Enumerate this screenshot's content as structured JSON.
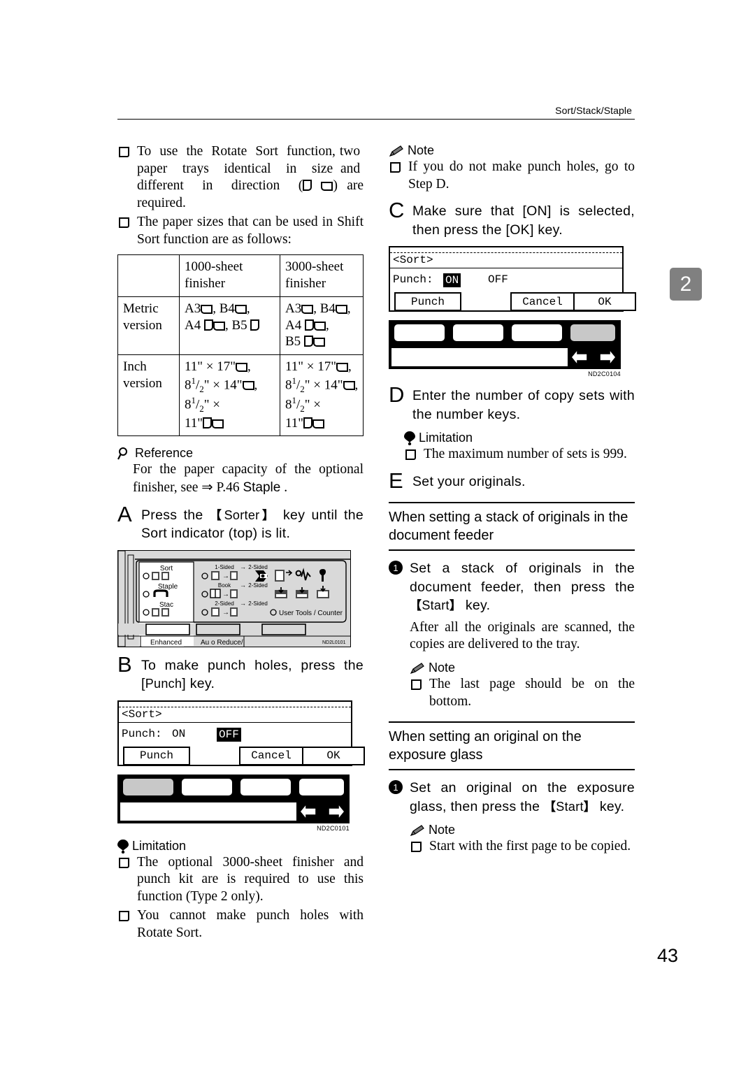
{
  "header": {
    "running_head": "Sort/Stack/Staple"
  },
  "chapter_tab": {
    "number": "2"
  },
  "page_number": "43",
  "left_column": {
    "intro_bullets": [
      "To use the Rotate Sort function, two paper trays identical in size and different in direction (  ) are required.",
      "The paper sizes that can be used in Shift Sort function are as follows:"
    ],
    "table": {
      "col_headers": [
        "",
        "1000-sheet finisher",
        "3000-sheet finisher"
      ],
      "rows": [
        {
          "label": "Metric version",
          "c1_lines": [
            "A3, B4,",
            "A4, B5"
          ],
          "c2_lines": [
            "A3, B4,",
            "A4,",
            "B5"
          ]
        },
        {
          "label": "Inch version",
          "c1_lines": [
            "11\" × 17\",",
            "8 1/2\" × 14\",",
            "8 1/2\" ×",
            "11\""
          ],
          "c2_lines": [
            "11\" × 17\",",
            "8 1/2\" × 14\",",
            "8 1/2\" ×",
            "11\""
          ]
        }
      ]
    },
    "reference": {
      "icon": "magnifier-icon",
      "title": "Reference",
      "body_pre": "For the paper capacity of the optional finisher, see ⇒ P.46 ",
      "body_link": "Staple",
      "body_post": " ."
    },
    "step_a": {
      "letter": "A",
      "text_1": "Press the ",
      "key": "Sorter",
      "text_2": " key until the Sort indicator (top) is lit."
    },
    "panel_figure": {
      "labels": {
        "sort": "Sort",
        "staple": "Staple",
        "stack": "Stac",
        "one_to_two": "1-Sided",
        "one_to_two_2": "2-Sided",
        "book": "Book",
        "book_2": "2-Sided",
        "two_to_two": "2-Sided",
        "two_to_two_2": "2-Sided",
        "user_tools": "User Tools / Counter",
        "enhanced": "Enhanced",
        "auto_reduce": "Au o Reduce/"
      },
      "code": "ND2L0101"
    },
    "step_b": {
      "letter": "B",
      "text_1": "To make punch holes, press the ",
      "key": "Punch",
      "text_2": " key."
    },
    "lcd_b": {
      "title": "<Sort>",
      "field_label": "Punch:",
      "option_on": "ON",
      "option_off": "OFF",
      "selected": "OFF",
      "btn_punch": "Punch",
      "btn_cancel": "Cancel",
      "btn_ok": "OK",
      "highlighted_key_index": 1,
      "code": "ND2C0101"
    },
    "limitation_b": {
      "icon": "balloon-icon",
      "title": "Limitation",
      "items": [
        "The optional 3000-sheet finisher and punch kit are is required to use this function (Type 2 only).",
        "You cannot make punch holes with Rotate Sort."
      ]
    }
  },
  "right_column": {
    "note_top": {
      "icon": "pencil-icon",
      "title": "Note",
      "items": [
        "If you do not make punch holes, go to Step D."
      ]
    },
    "step_c": {
      "letter": "C",
      "text": "Make sure that [ON] is selected, then press the [OK] key."
    },
    "lcd_c": {
      "title": "<Sort>",
      "field_label": "Punch:",
      "option_on": "ON",
      "option_off": "OFF",
      "selected": "ON",
      "btn_punch": "Punch",
      "btn_cancel": "Cancel",
      "btn_ok": "OK",
      "highlighted_key_index": 4,
      "code": "ND2C0104"
    },
    "step_d": {
      "letter": "D",
      "text": "Enter the number of copy sets with the number keys."
    },
    "limitation_d": {
      "icon": "balloon-icon",
      "title": "Limitation",
      "items": [
        "The maximum number of sets is 999."
      ]
    },
    "step_e": {
      "letter": "E",
      "text": "Set your originals."
    },
    "subsection_feeder": {
      "heading": "When setting a stack of originals in the document feeder",
      "step_1": {
        "num": "1",
        "text_1": "Set a stack of originals in the document feeder, then press the ",
        "key": "Start",
        "text_2": " key."
      },
      "body": "After all the originals are scanned, the copies are delivered to the tray.",
      "note": {
        "icon": "pencil-icon",
        "title": "Note",
        "items": [
          "The last page should be on the bottom."
        ]
      }
    },
    "subsection_glass": {
      "heading": "When setting an original on the exposure glass",
      "step_1": {
        "num": "1",
        "text_1": "Set an original on the exposure glass, then press the ",
        "key": "Start",
        "text_2": " key."
      },
      "note": {
        "icon": "pencil-icon",
        "title": "Note",
        "items": [
          "Start with the first page to be copied."
        ]
      }
    }
  }
}
